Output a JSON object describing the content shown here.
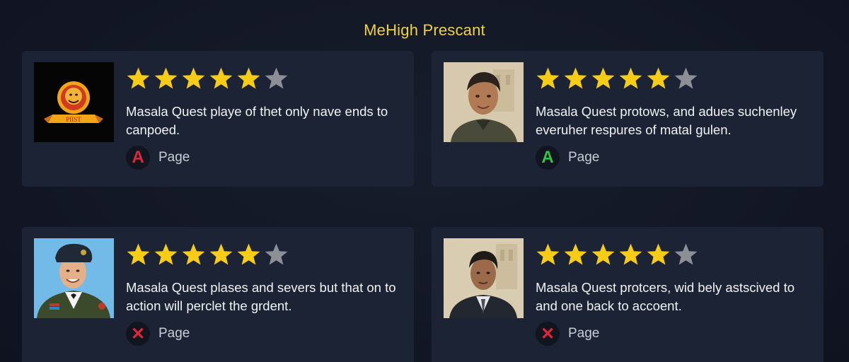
{
  "header": {
    "title": "MeHigh Prescant"
  },
  "colors": {
    "title": "#f0d43a",
    "star_filled": "#f6cc16",
    "star_empty": "#8c8f96",
    "badge_red": "#e0263a",
    "badge_green": "#33c24a"
  },
  "reviews": [
    {
      "rating": 5,
      "max_rating": 6,
      "text": "Masala Quest playe of thet only nave ends to canpoed.",
      "source_icon": "letter-a-icon",
      "source_letter": "A",
      "source_color": "#e0263a",
      "source_label": "Page",
      "image": "crest-logo",
      "logo_text": "PIIST"
    },
    {
      "rating": 5,
      "max_rating": 6,
      "text": "Masala Quest protows, and adues suchenley everuher respures of matal gulen.",
      "source_icon": "letter-a-icon",
      "source_letter": "A",
      "source_color": "#33c24a",
      "source_label": "Page",
      "image": "man-portrait-photo"
    },
    {
      "rating": 5,
      "max_rating": 6,
      "text": "Masala Quest plases and severs but that on to action will perclet the grdent.",
      "source_icon": "x-icon",
      "source_letter": "✕",
      "source_color": "#e0263a",
      "source_label": "Page",
      "image": "officer-portrait-photo"
    },
    {
      "rating": 5,
      "max_rating": 6,
      "text": "Masala Quest protcers, wid bely astscived to and one back to accoent.",
      "source_icon": "x-icon",
      "source_letter": "✕",
      "source_color": "#e0263a",
      "source_label": "Page",
      "image": "man-suit-portrait-photo"
    }
  ]
}
